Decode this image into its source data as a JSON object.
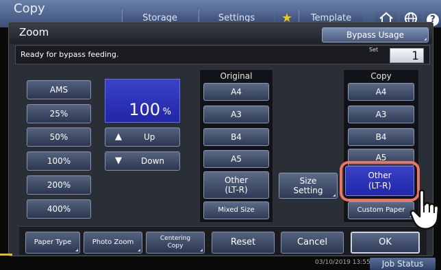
{
  "topbar": {
    "title": "Copy",
    "tabs": [
      "Storage",
      "Settings",
      "Template"
    ],
    "icons": [
      "star-icon",
      "home-icon",
      "globe-icon",
      "help-icon"
    ],
    "help_glyph": "?"
  },
  "screen": {
    "title": "Zoom",
    "bypass_button": "Bypass Usage",
    "status": "Ready for bypass feeding.",
    "set_label": "Set",
    "set_value": "1"
  },
  "zoom": {
    "presets": [
      "AMS",
      "25%",
      "50%",
      "100%",
      "200%",
      "400%"
    ],
    "value": "100",
    "unit": "%",
    "up": "Up",
    "down": "Down"
  },
  "original": {
    "header": "Original",
    "sizes": [
      "A4",
      "A3",
      "B4",
      "A5"
    ],
    "other_line1": "Other",
    "other_line2": "(LT-R)",
    "mixed": "Mixed Size"
  },
  "size_setting": {
    "line1": "Size",
    "line2": "Setting"
  },
  "copy": {
    "header": "Copy",
    "sizes": [
      "A4",
      "A3",
      "B4",
      "A5"
    ],
    "other_line1": "Other",
    "other_line2": "(LT-R)",
    "custom": "Custom Paper"
  },
  "bottom": {
    "paper_type": "Paper Type",
    "photo_zoom": "Photo Zoom",
    "centering_line1": "Centering",
    "centering_line2": "Copy",
    "reset": "Reset",
    "cancel": "Cancel",
    "ok": "OK"
  },
  "footer": {
    "date": "03/10/2019",
    "time": "13:55",
    "job_status": "Job Status"
  },
  "colors": {
    "accent_highlight": "#ec7462",
    "selected_blue": "#2226a8",
    "topbar_blue": "#3b4f78"
  }
}
